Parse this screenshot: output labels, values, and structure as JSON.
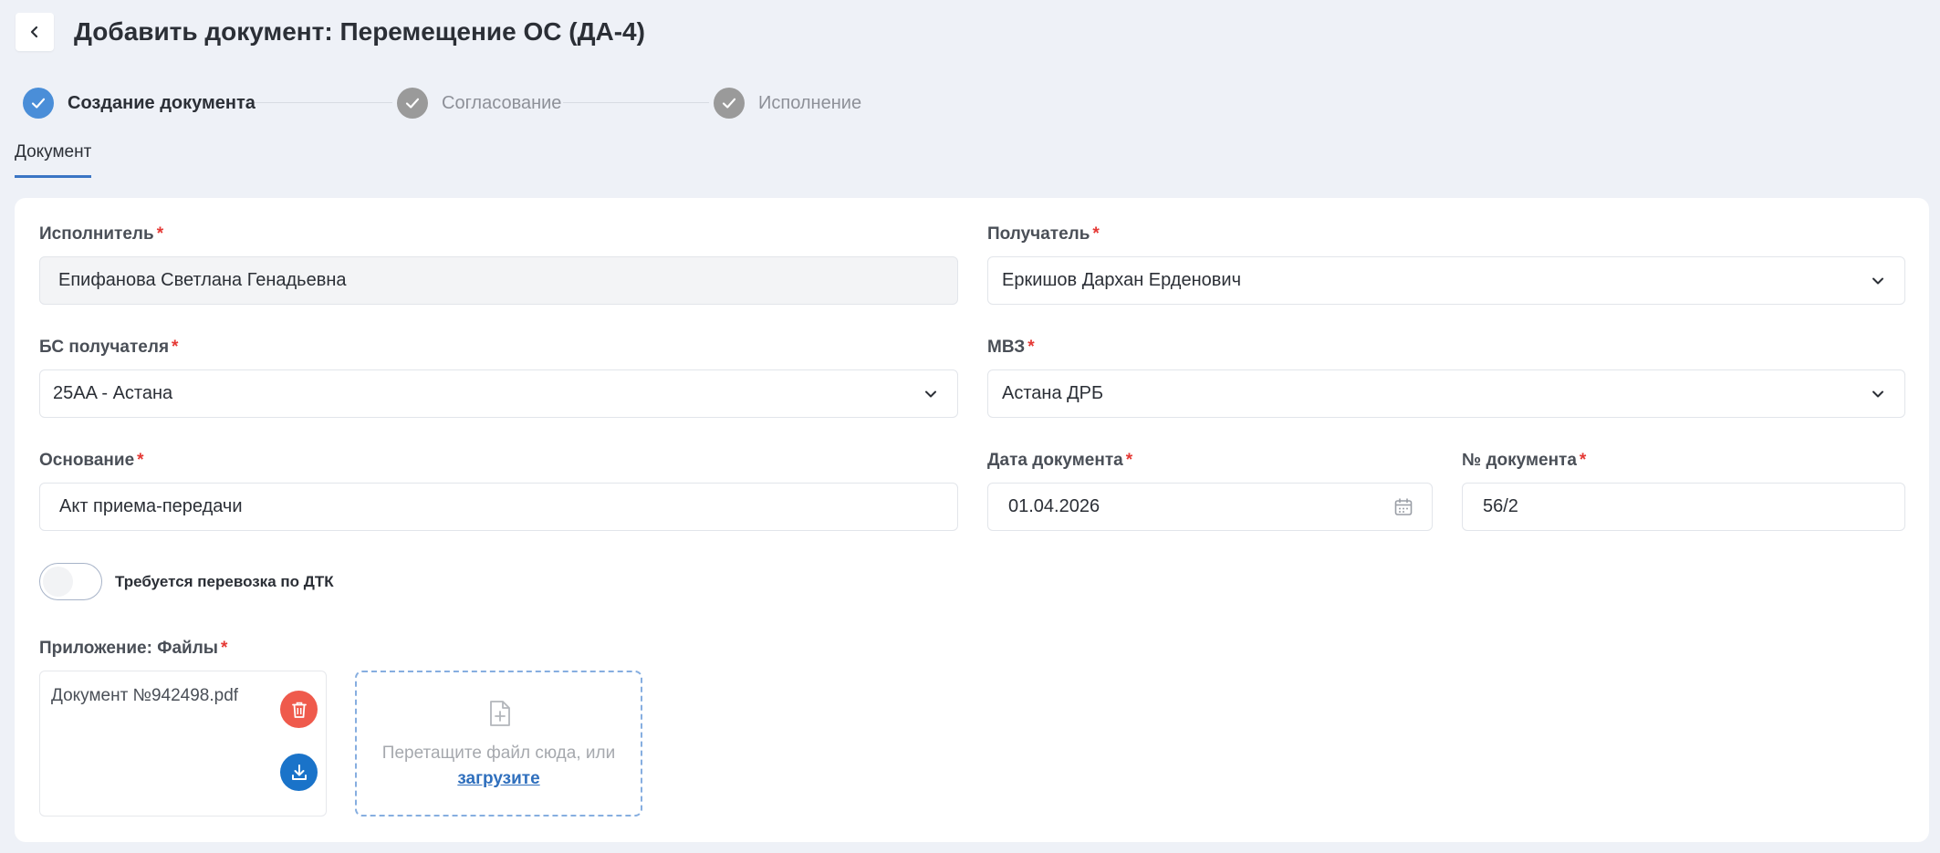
{
  "header": {
    "title": "Добавить документ: Перемещение ОС (ДА-4)"
  },
  "stepper": {
    "steps": [
      {
        "label": "Создание документа",
        "state": "active"
      },
      {
        "label": "Согласование",
        "state": "inactive"
      },
      {
        "label": "Исполнение",
        "state": "inactive"
      }
    ]
  },
  "tabs": [
    {
      "label": "Документ",
      "selected": true
    }
  ],
  "form": {
    "required_mark": "*",
    "executor": {
      "label": "Исполнитель",
      "value": "Епифанова Светлана Генадьевна"
    },
    "recipient": {
      "label": "Получатель",
      "value": "Еркишов Дархан Ерденович"
    },
    "recipient_bs": {
      "label": "БС получателя",
      "value": "25AA - Астана"
    },
    "mvz": {
      "label": "МВЗ",
      "value": "Астана ДРБ"
    },
    "basis": {
      "label": "Основание",
      "value": "Акт приема-передачи"
    },
    "doc_date": {
      "label": "Дата документа",
      "value": "01.04.2026"
    },
    "doc_number": {
      "label": "№ документа",
      "value": "56/2"
    },
    "transport_toggle": {
      "label": "Требуется перевозка по ДТК",
      "checked": false
    },
    "attachments": {
      "label": "Приложение: Файлы",
      "files": [
        {
          "name": "Документ №942498.pdf"
        }
      ],
      "dropzone": {
        "text": "Перетащите файл сюда, или",
        "link": "загрузите"
      }
    }
  },
  "colors": {
    "accent": "#3a75c4",
    "step_active": "#4a8ed8",
    "delete": "#ef5a4c",
    "download": "#1a73c9",
    "required": "#e53935"
  }
}
